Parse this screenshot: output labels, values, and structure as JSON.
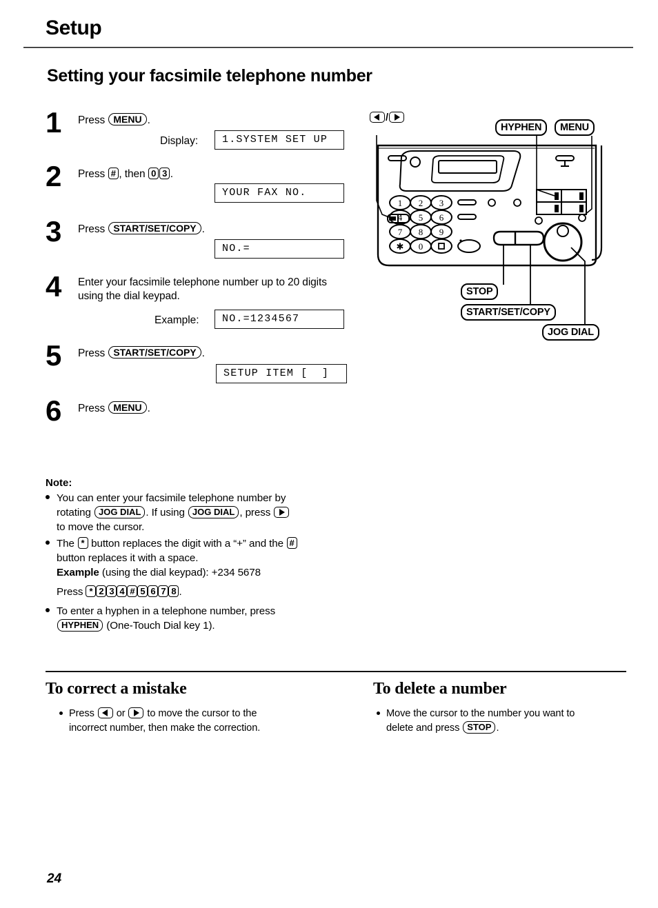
{
  "header": {
    "chapter": "Setup",
    "section": "Setting your facsimile telephone number"
  },
  "steps": [
    {
      "num": "1",
      "text_parts": [
        "Press ",
        "MENU",
        "."
      ],
      "key": "MENU",
      "display_label": "Display:",
      "display_value": "1.SYSTEM SET UP"
    },
    {
      "num": "2",
      "prefix": "Press ",
      "key1": "#",
      "middle": ", then ",
      "key2": "0",
      "key3": "3",
      "suffix": ".",
      "display_value": "YOUR FAX NO."
    },
    {
      "num": "3",
      "prefix": "Press ",
      "key": "START/SET/COPY",
      "suffix": ".",
      "display_value": "NO.="
    },
    {
      "num": "4",
      "text": "Enter your facsimile telephone number up to 20 digits using the dial keypad.",
      "display_label": "Example:",
      "display_value": "NO.=1234567"
    },
    {
      "num": "5",
      "prefix": "Press ",
      "key": "START/SET/COPY",
      "suffix": ".",
      "display_value": "SETUP ITEM [  ]"
    },
    {
      "num": "6",
      "prefix": "Press ",
      "key": "MENU",
      "suffix": "."
    }
  ],
  "note": {
    "title": "Note:",
    "item1": {
      "a": "You can enter your facsimile telephone number by",
      "b_pre": "rotating ",
      "b_key1": "JOG DIAL",
      "b_mid": ". If using ",
      "b_key2": "JOG DIAL",
      "b_post": ", press ",
      "b_arrow": "right-arrow",
      "c": "to move the cursor."
    },
    "item2": {
      "a_pre": "The ",
      "a_star": "*",
      "a_mid": " button replaces the digit with a “+” and the ",
      "a_hash": "#",
      "b": "button replaces it with a space.",
      "ex_label": "Example",
      "ex_text": " (using the dial keypad):  +234  5678",
      "press_label": "Press ",
      "press_keys": [
        "*",
        "2",
        "3",
        "4",
        "#",
        "5",
        "6",
        "7",
        "8"
      ],
      "press_suffix": "."
    },
    "item3": {
      "a": "To enter a hyphen in a telephone number, press",
      "b_key": "HYPHEN",
      "b_text": " (One-Touch Dial key 1)."
    }
  },
  "bottom": {
    "left": {
      "title": "To correct a mistake",
      "line1_pre": "Press ",
      "arrow_left": "left-arrow",
      "line1_mid": " or ",
      "arrow_right": "right-arrow",
      "line1_post": " to move the cursor to the",
      "line2": "incorrect number, then make the correction."
    },
    "right": {
      "title": "To delete a number",
      "line1": "Move the cursor to the number you want to",
      "line2_pre": "delete and press ",
      "line2_key": "STOP",
      "line2_post": "."
    }
  },
  "diagram": {
    "callouts": {
      "arrows": "◀/▶",
      "hyphen": "HYPHEN",
      "menu": "MENU",
      "stop": "STOP",
      "start_set_copy": "START/SET/COPY",
      "jog_dial": "JOG DIAL"
    },
    "keypad": [
      [
        "1",
        "2",
        "3"
      ],
      [
        "4",
        "5",
        "6"
      ],
      [
        "7",
        "8",
        "9"
      ],
      [
        "*",
        "0",
        "#"
      ]
    ]
  },
  "page_number": "24",
  "colors": {
    "ink": "#000000",
    "paper": "#ffffff"
  }
}
